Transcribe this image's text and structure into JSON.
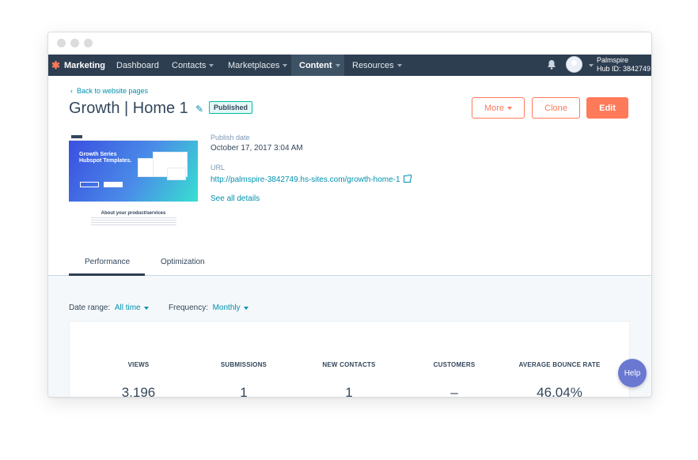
{
  "nav": {
    "brand": "Marketing",
    "items": [
      {
        "label": "Dashboard",
        "has_caret": false
      },
      {
        "label": "Contacts",
        "has_caret": true
      },
      {
        "label": "Marketplaces",
        "has_caret": true
      },
      {
        "label": "Content",
        "has_caret": true,
        "active": true
      },
      {
        "label": "Resources",
        "has_caret": true
      }
    ],
    "account_name": "Palmspire",
    "hub_id": "Hub ID: 3842749",
    "icons": [
      "bell-icon",
      "avatar",
      "sprocket-icon"
    ]
  },
  "header": {
    "back_link": "Back to website pages",
    "title": "Growth | Home 1",
    "status": "Published"
  },
  "actions": {
    "more": "More",
    "clone": "Clone",
    "edit": "Edit"
  },
  "preview": {
    "hero_heading": "Growth Series Hubspot Templates.",
    "about_heading": "About your product/services"
  },
  "details": {
    "publish_label": "Publish date",
    "publish_value": "October 17, 2017 3:04 AM",
    "url_label": "URL",
    "url_value": "http://palmspire-3842749.hs-sites.com/growth-home-1",
    "see_all": "See all details"
  },
  "tabs": [
    {
      "label": "Performance",
      "active": true
    },
    {
      "label": "Optimization",
      "active": false
    }
  ],
  "filters": {
    "date_label": "Date range:",
    "date_value": "All time",
    "freq_label": "Frequency:",
    "freq_value": "Monthly"
  },
  "stats": [
    {
      "label": "VIEWS",
      "value": "3,196"
    },
    {
      "label": "SUBMISSIONS",
      "value": "1"
    },
    {
      "label": "NEW CONTACTS",
      "value": "1"
    },
    {
      "label": "CUSTOMERS",
      "value": "–"
    },
    {
      "label": "AVERAGE BOUNCE RATE",
      "value": "46.04%"
    }
  ],
  "help": "Help",
  "colors": {
    "nav_bg": "#2d3e50",
    "accent": "#ff7a59",
    "link": "#0091ae",
    "help": "#6a78d1"
  }
}
